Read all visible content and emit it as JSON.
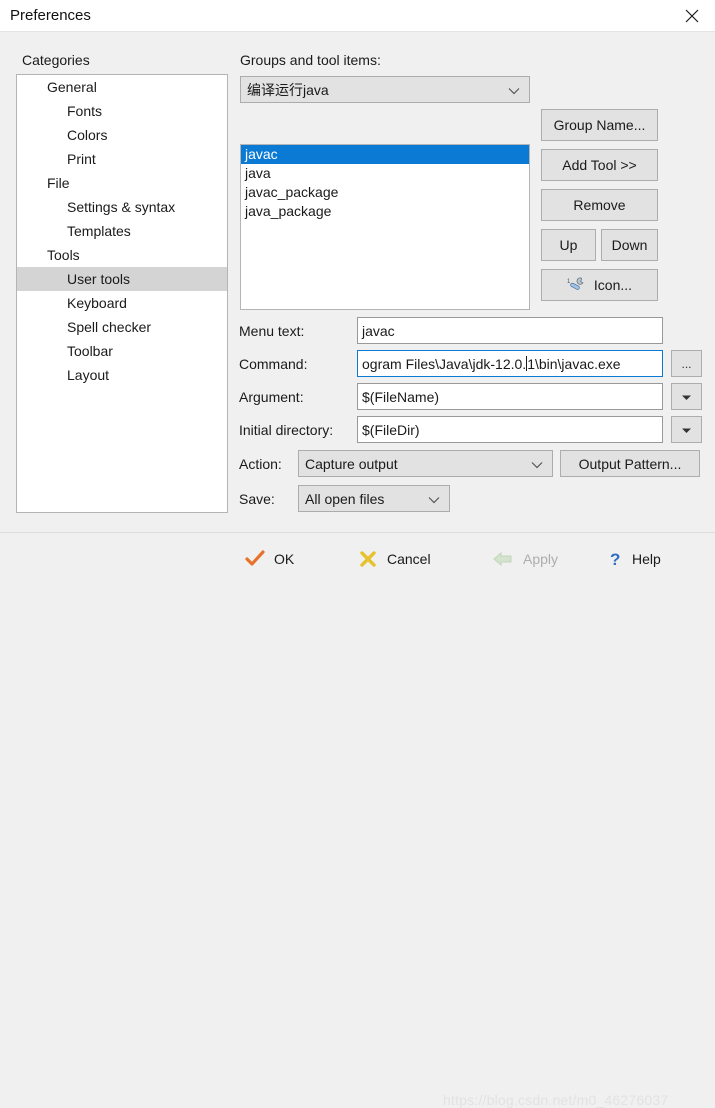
{
  "window": {
    "title": "Preferences",
    "close_icon": "close-icon"
  },
  "categories": {
    "label": "Categories",
    "items": [
      {
        "label": "General",
        "level": 0,
        "selected": false
      },
      {
        "label": "Fonts",
        "level": 1,
        "selected": false
      },
      {
        "label": "Colors",
        "level": 1,
        "selected": false
      },
      {
        "label": "Print",
        "level": 1,
        "selected": false
      },
      {
        "label": "File",
        "level": 0,
        "selected": false
      },
      {
        "label": "Settings & syntax",
        "level": 1,
        "selected": false
      },
      {
        "label": "Templates",
        "level": 1,
        "selected": false
      },
      {
        "label": "Tools",
        "level": 0,
        "selected": false
      },
      {
        "label": "User tools",
        "level": 1,
        "selected": true
      },
      {
        "label": "Keyboard",
        "level": 1,
        "selected": false
      },
      {
        "label": "Spell checker",
        "level": 1,
        "selected": false
      },
      {
        "label": "Toolbar",
        "level": 1,
        "selected": false
      },
      {
        "label": "Layout",
        "level": 1,
        "selected": false
      }
    ]
  },
  "groups": {
    "label": "Groups and tool items:",
    "selected_group": "编译运行java",
    "tools": [
      {
        "label": "javac",
        "selected": true
      },
      {
        "label": "java",
        "selected": false
      },
      {
        "label": "javac_package",
        "selected": false
      },
      {
        "label": "java_package",
        "selected": false
      }
    ],
    "buttons": {
      "group_name": "Group Name...",
      "add_tool": "Add Tool >>",
      "remove": "Remove",
      "up": "Up",
      "down": "Down",
      "icon": "Icon..."
    }
  },
  "form": {
    "menu_text_label": "Menu text:",
    "menu_text_value": "javac",
    "command_label": "Command:",
    "command_value_before_caret": "ogram Files\\Java\\jdk-12.0.",
    "command_value_after_caret": "1\\bin\\javac.exe",
    "browse_button": "...",
    "argument_label": "Argument:",
    "argument_value": "$(FileName)",
    "initial_directory_label": "Initial directory:",
    "initial_directory_value": "$(FileDir)",
    "action_label": "Action:",
    "action_value": "Capture output",
    "output_pattern_button": "Output Pattern...",
    "save_label": "Save:",
    "save_value": "All open files"
  },
  "footer": {
    "ok": "OK",
    "cancel": "Cancel",
    "apply": "Apply",
    "help": "Help",
    "watermark": "https://blog.csdn.net/m0_46276037"
  },
  "colors": {
    "selection_blue": "#0b7ad5",
    "tree_selection_gray": "#d4d4d4",
    "dialog_bg": "#f0f0f0",
    "titlebar_bg": "#ffffff",
    "ok_check": "#e8722c",
    "cancel_x": "#e8c22c",
    "apply_arrow": "#c9dcc2",
    "help_question": "#2f6fc4"
  }
}
